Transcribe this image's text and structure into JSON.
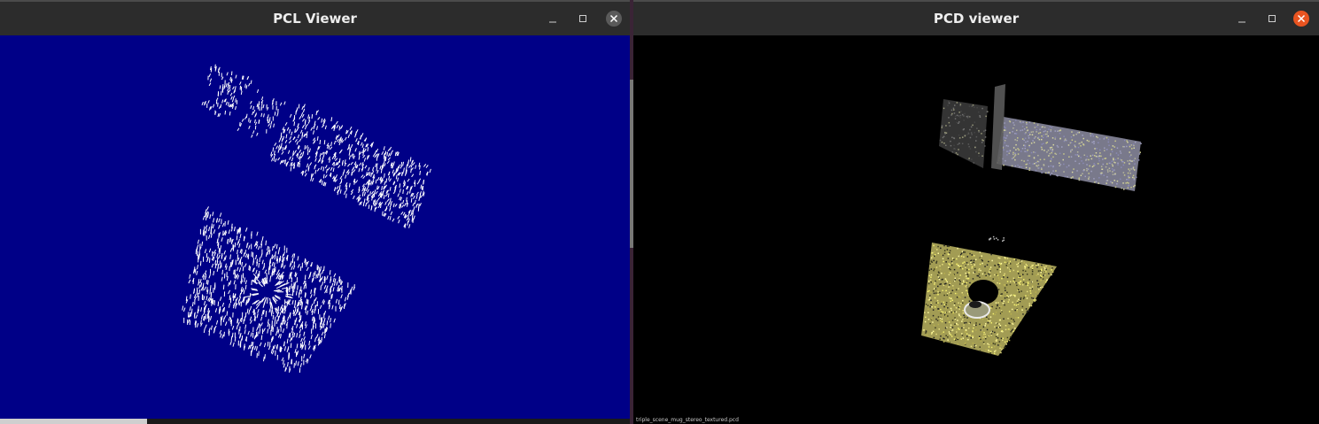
{
  "left_window": {
    "title": "PCL Viewer",
    "background_color": "#000087",
    "point_color": "#ffffff",
    "controls": [
      "minimize-icon",
      "maximize-icon",
      "close-icon"
    ]
  },
  "right_window": {
    "title": "PCD viewer",
    "background_color": "#000000",
    "controls": [
      "minimize-icon",
      "maximize-icon",
      "close-icon"
    ],
    "close_color": "#e95420",
    "status_text": "triple_scene_mug_stereo_textured.pcd"
  }
}
